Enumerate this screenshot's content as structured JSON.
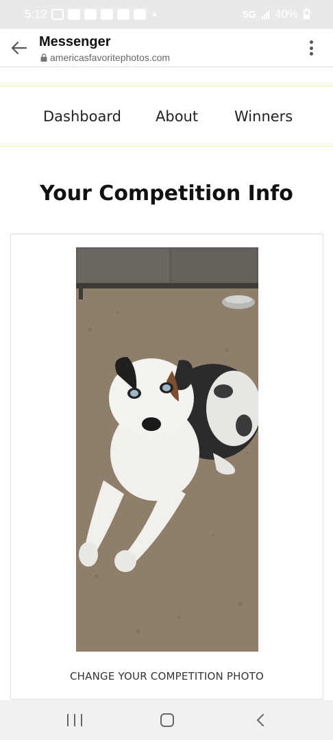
{
  "status_bar": {
    "time": "5:12",
    "network": "5G",
    "battery": "40%"
  },
  "browser": {
    "title": "Messenger",
    "url": "americasfavoritephotos.com"
  },
  "nav": {
    "dashboard": "Dashboard",
    "about": "About",
    "winners": "Winners"
  },
  "page": {
    "title": "Your Competition Info",
    "change_photo": "CHANGE YOUR COMPETITION PHOTO"
  },
  "colors": {
    "divider_accent": "#eef3a0",
    "status_bar_bg": "#e9e9ea"
  }
}
